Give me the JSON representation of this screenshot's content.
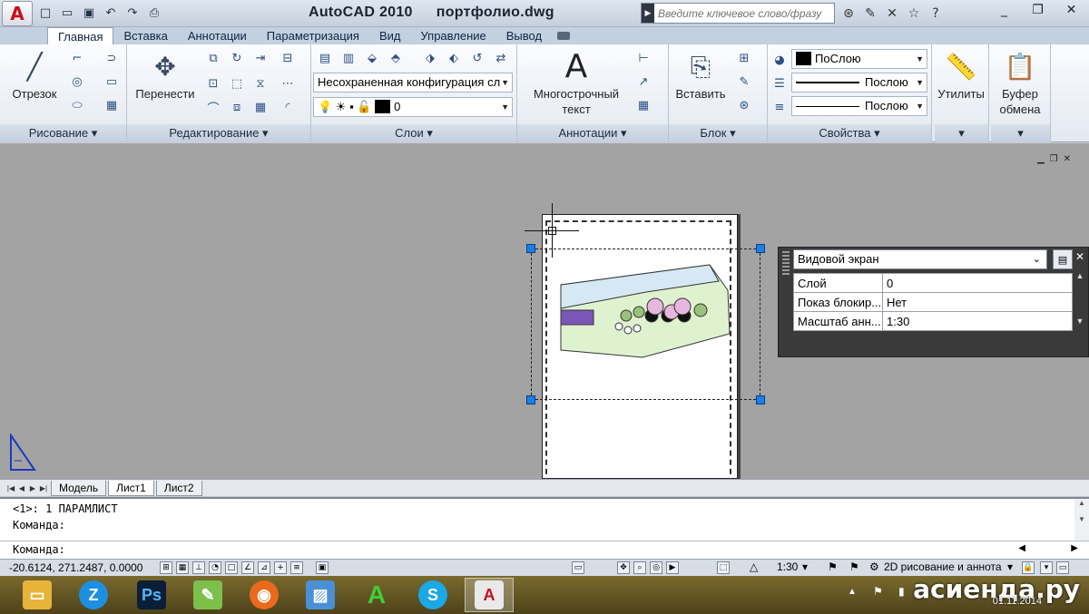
{
  "title": {
    "app": "AutoCAD 2010",
    "file": "портфолио.dwg"
  },
  "search": {
    "placeholder": "Введите ключевое слово/фразу"
  },
  "tabs": [
    "Главная",
    "Вставка",
    "Аннотации",
    "Параметризация",
    "Вид",
    "Управление",
    "Вывод"
  ],
  "ribbon": {
    "draw": {
      "label": "Рисование",
      "line_btn": "Отрезок"
    },
    "modify": {
      "label": "Редактирование",
      "move_btn": "Перенести"
    },
    "layers": {
      "label": "Слои",
      "state_combo": "Несохраненная конфигурация сл",
      "layer_combo": "0"
    },
    "annotation": {
      "label": "Аннотации",
      "mtext_btn": "Многострочный текст"
    },
    "block": {
      "label": "Блок",
      "insert_btn": "Вставить"
    },
    "properties": {
      "label": "Свойства",
      "color": "ПоСлою",
      "linetype": "Послою",
      "lineweight": "Послою"
    },
    "utilities": {
      "label": "Утилиты"
    },
    "clipboard": {
      "label": "Буфер обмена"
    }
  },
  "props_palette": {
    "selected_type": "Видовой экран",
    "rows": [
      {
        "key": "Слой",
        "value": "0"
      },
      {
        "key": "Показ блокир...",
        "value": "Нет"
      },
      {
        "key": "Масштаб анн...",
        "value": "1:30"
      }
    ]
  },
  "layout_tabs": [
    "Модель",
    "Лист1",
    "Лист2"
  ],
  "command": {
    "line1": "<1>: 1 ПАРАМЛИСТ",
    "line2": "Команда:",
    "prompt": "Команда:"
  },
  "status": {
    "coords": "-20.6124, 271.2487, 0.0000",
    "scale": "1:30",
    "workspace": "2D рисование и аннота"
  },
  "taskbar": {
    "date": "01.11.2014",
    "watermark": "асиенда.ру"
  }
}
